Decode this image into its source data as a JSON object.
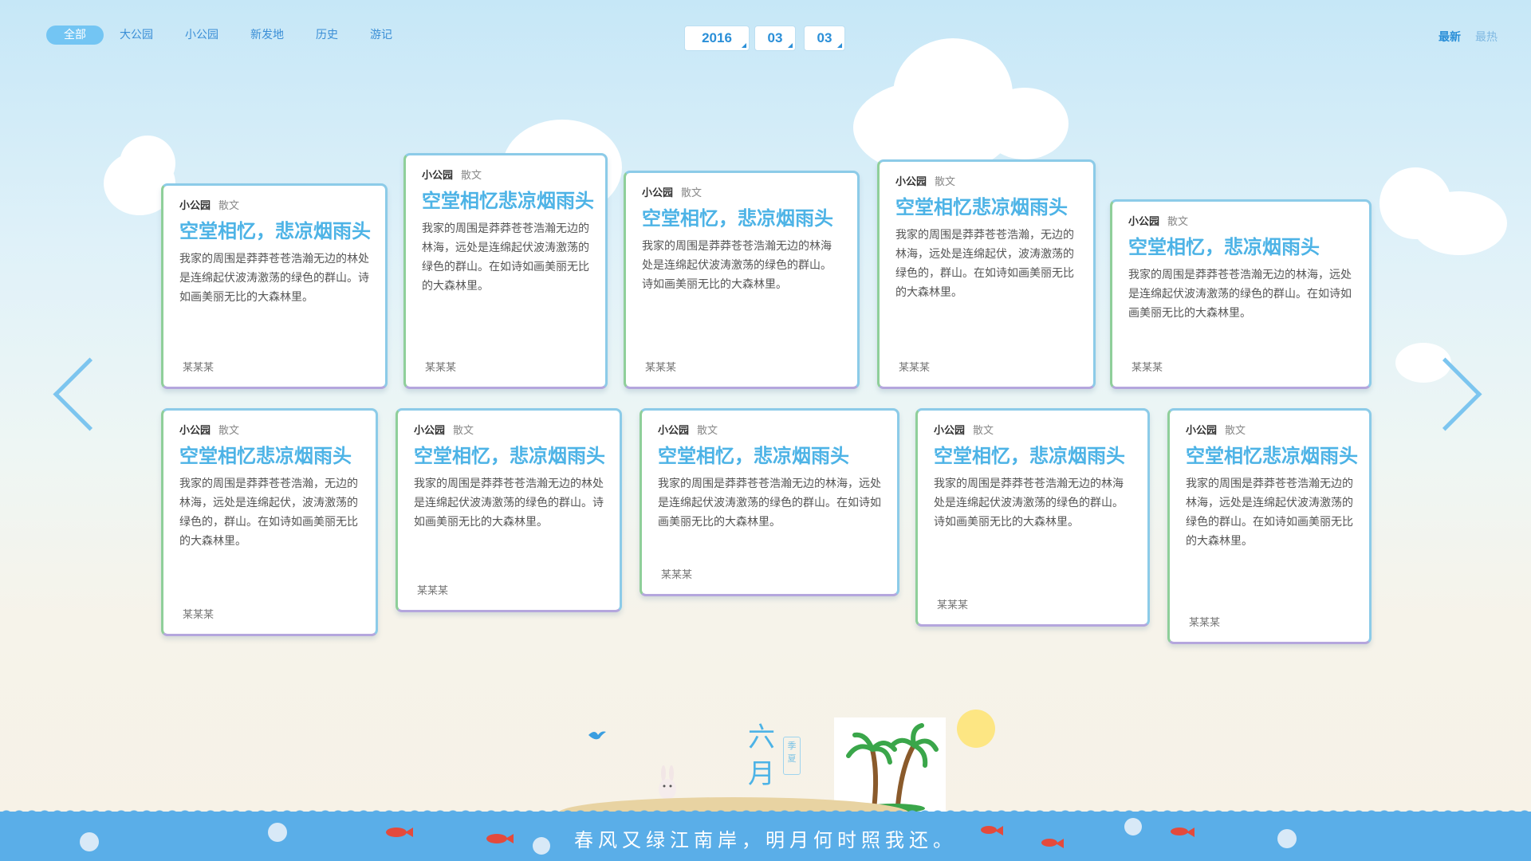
{
  "nav": {
    "tabs": [
      {
        "label": "全部",
        "active": true
      },
      {
        "label": "大公园"
      },
      {
        "label": "小公园"
      },
      {
        "label": "新发地"
      },
      {
        "label": "历史"
      },
      {
        "label": "游记"
      }
    ]
  },
  "date": {
    "year": "2016",
    "month": "03",
    "day": "03"
  },
  "sort": {
    "newest": "最新",
    "hottest": "最热"
  },
  "cards": [
    {
      "category": "小公园",
      "genre": "散文",
      "title": "空堂相忆，悲凉烟雨头",
      "body": "我家的周围是莽莽苍苍浩瀚无边的林处是连绵起伏波涛激荡的绿色的群山。诗如画美丽无比的大森林里。",
      "author": "某某某"
    },
    {
      "category": "小公园",
      "genre": "散文",
      "title": "空堂相忆悲凉烟雨头",
      "body": "我家的周围是莽莽苍苍浩瀚无边的林海，远处是连绵起伏波涛激荡的绿色的群山。在如诗如画美丽无比的大森林里。",
      "author": "某某某"
    },
    {
      "category": "小公园",
      "genre": "散文",
      "title": "空堂相忆，悲凉烟雨头",
      "body": "我家的周围是莽莽苍苍浩瀚无边的林海处是连绵起伏波涛激荡的绿色的群山。诗如画美丽无比的大森林里。",
      "author": "某某某"
    },
    {
      "category": "小公园",
      "genre": "散文",
      "title": "空堂相忆悲凉烟雨头",
      "body": "我家的周围是莽莽苍苍浩瀚，无边的林海，远处是连绵起伏，波涛激荡的绿色的，群山。在如诗如画美丽无比的大森林里。",
      "author": "某某某"
    },
    {
      "category": "小公园",
      "genre": "散文",
      "title": "空堂相忆，悲凉烟雨头",
      "body": "我家的周围是莽莽苍苍浩瀚无边的林海，远处是连绵起伏波涛激荡的绿色的群山。在如诗如画美丽无比的大森林里。",
      "author": "某某某"
    },
    {
      "category": "小公园",
      "genre": "散文",
      "title": "空堂相忆悲凉烟雨头",
      "body": "我家的周围是莽莽苍苍浩瀚，无边的林海，远处是连绵起伏，波涛激荡的绿色的，群山。在如诗如画美丽无比的大森林里。",
      "author": "某某某"
    },
    {
      "category": "小公园",
      "genre": "散文",
      "title": "空堂相忆，悲凉烟雨头",
      "body": "我家的周围是莽莽苍苍浩瀚无边的林处是连绵起伏波涛激荡的绿色的群山。诗如画美丽无比的大森林里。",
      "author": "某某某"
    },
    {
      "category": "小公园",
      "genre": "散文",
      "title": "空堂相忆，悲凉烟雨头",
      "body": "我家的周围是莽莽苍苍浩瀚无边的林海，远处是连绵起伏波涛激荡的绿色的群山。在如诗如画美丽无比的大森林里。",
      "author": "某某某"
    },
    {
      "category": "小公园",
      "genre": "散文",
      "title": "空堂相忆，悲凉烟雨头",
      "body": "我家的周围是莽莽苍苍浩瀚无边的林海处是连绵起伏波涛激荡的绿色的群山。诗如画美丽无比的大森林里。",
      "author": "某某某"
    },
    {
      "category": "小公园",
      "genre": "散文",
      "title": "空堂相忆悲凉烟雨头",
      "body": "我家的周围是莽莽苍苍浩瀚无边的林海，远处是连绵起伏波涛激荡的绿色的群山。在如诗如画美丽无比的大森林里。",
      "author": "某某某"
    }
  ],
  "footer": {
    "month": "六月",
    "season": "季夏",
    "poem": "春风又绿江南岸，明月何时照我还。"
  },
  "colors": {
    "accent": "#4db3e6",
    "tab_active": "#73c5f3",
    "sea": "#5aaee8"
  }
}
